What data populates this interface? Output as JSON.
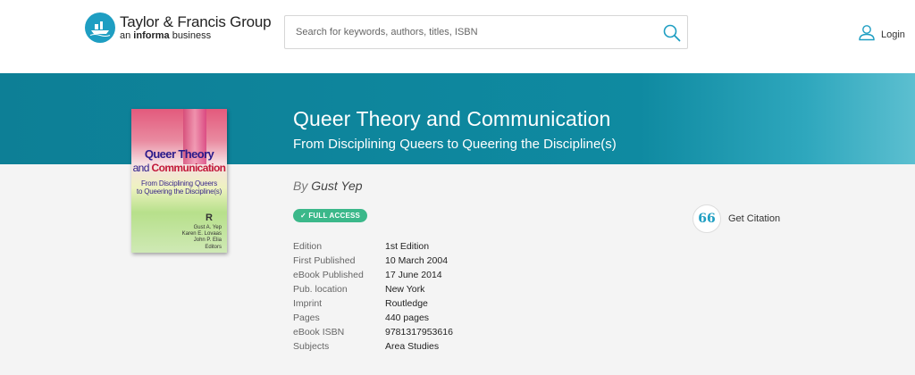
{
  "header": {
    "logo_main": "Taylor & Francis Group",
    "logo_sub_prefix": "an ",
    "logo_sub_bold": "informa",
    "logo_sub_suffix": " business",
    "search_placeholder": "Search for keywords, authors, titles, ISBN",
    "search_icon": "search-icon",
    "login_label": "Login",
    "login_icon": "user-icon"
  },
  "book": {
    "title": "Queer Theory and Communication",
    "subtitle": "From Disciplining Queers to Queering the Discipline(s)",
    "by_label": "By",
    "author": "Gust Yep",
    "access_badge": "✓ FULL ACCESS",
    "cover": {
      "line1": "Queer Theory",
      "line2_prefix": "and ",
      "line2_bold": "Communication",
      "line3": "From Disciplining Queers",
      "line4": "to Queering the Discipline(s)",
      "publisher_mark": "R",
      "editor1": "Gust A. Yep",
      "editor2": "Karen E. Lovaas",
      "editor3": "John P. Elia",
      "editors_label": "Editors"
    }
  },
  "details": [
    {
      "label": "Edition",
      "value": "1st Edition"
    },
    {
      "label": "First Published",
      "value": "10 March 2004"
    },
    {
      "label": "eBook Published",
      "value": "17 June 2014"
    },
    {
      "label": "Pub. location",
      "value": "New York"
    },
    {
      "label": "Imprint",
      "value": "Routledge"
    },
    {
      "label": "Pages",
      "value": "440 pages"
    },
    {
      "label": "eBook ISBN",
      "value": "9781317953616"
    },
    {
      "label": "Subjects",
      "value": "Area Studies"
    }
  ],
  "citation": {
    "label": "Get Citation",
    "icon_glyph": "66"
  },
  "colors": {
    "brand": "#1e9ec2",
    "banner": "#0f8aa1",
    "badge": "#3bb88a"
  }
}
